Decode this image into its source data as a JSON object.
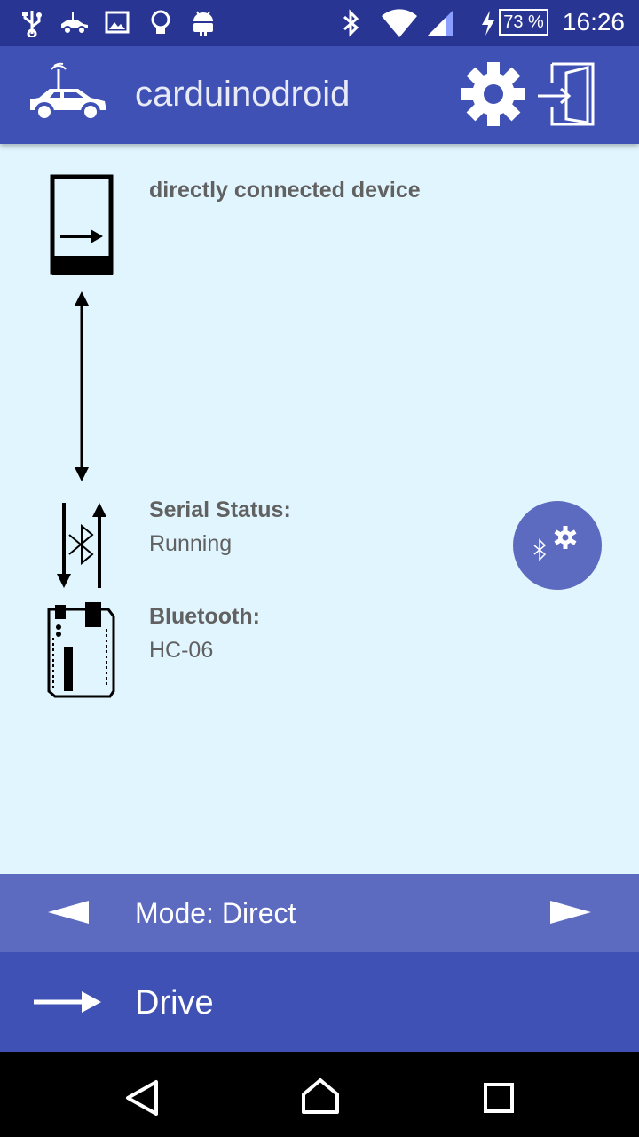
{
  "status_bar": {
    "battery": "73 %",
    "time": "16:26"
  },
  "app_bar": {
    "title": "carduinodroid"
  },
  "device": {
    "heading": "directly connected device"
  },
  "serial": {
    "label": "Serial Status:",
    "value": "Running"
  },
  "bluetooth": {
    "label": "Bluetooth:",
    "value": "HC-06"
  },
  "mode_bar": {
    "label": "Mode: Direct"
  },
  "drive_bar": {
    "label": "Drive"
  },
  "colors": {
    "status_bar": "#283593",
    "app_bar": "#3f51b5",
    "content_bg": "#e1f5fe",
    "mode_bar": "#5c6bc0",
    "fab": "#5c6bc0"
  },
  "icons": [
    "usb-icon",
    "car-notification-icon",
    "image-icon",
    "bulb-icon",
    "android-icon",
    "bluetooth-status-icon",
    "wifi-icon",
    "signal-icon",
    "charging-icon",
    "battery-icon",
    "car-logo-icon",
    "settings-gear-icon",
    "exit-icon",
    "phone-arrow-icon",
    "double-arrow-icon",
    "serial-bluetooth-icon",
    "arduino-board-icon",
    "bluetooth-settings-icon",
    "arrow-left-icon",
    "arrow-right-icon",
    "drive-arrow-icon",
    "back-icon",
    "home-icon",
    "recents-icon"
  ]
}
